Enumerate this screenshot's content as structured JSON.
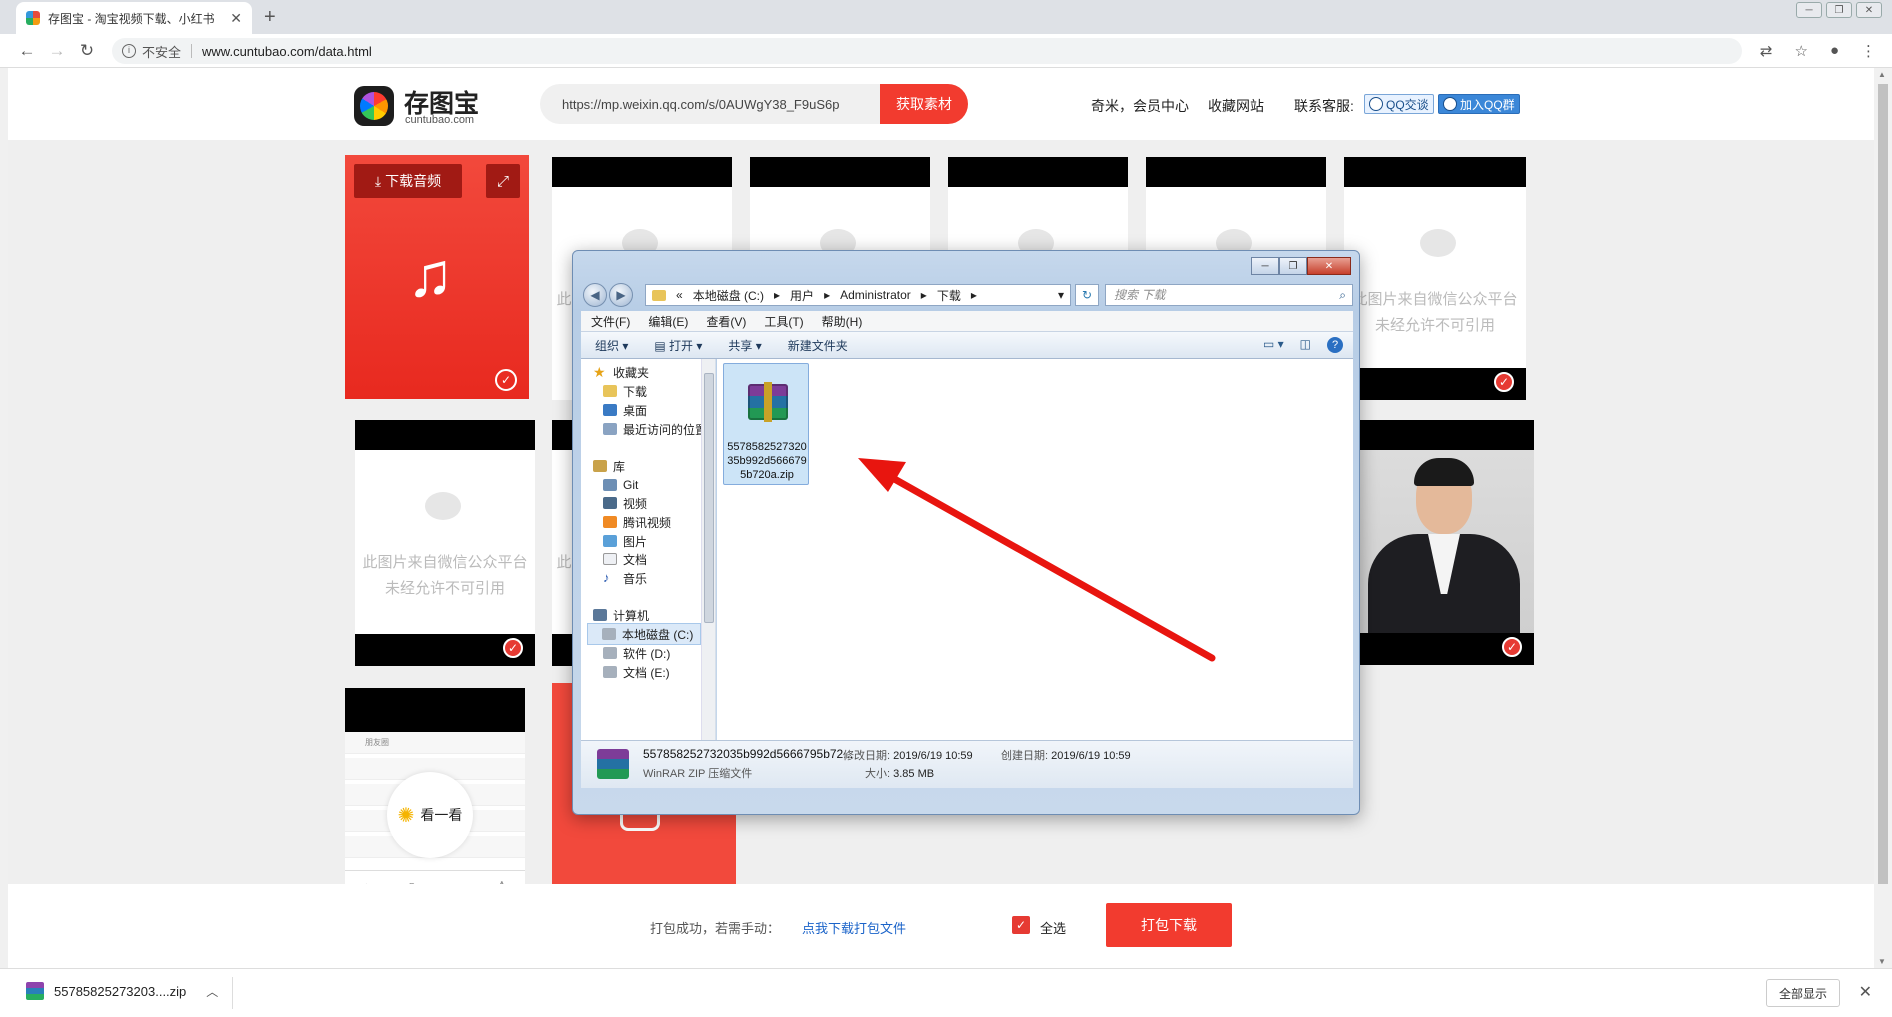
{
  "browser": {
    "tab_title": "存图宝 - 淘宝视频下载、小红书",
    "tab_close": "✕",
    "new_tab": "+",
    "security_label": "不安全",
    "url": "www.cuntubao.com/data.html",
    "window_controls": [
      "─",
      "❐",
      "✕"
    ]
  },
  "header": {
    "brand": "存图宝",
    "domain": "cuntubao.com",
    "search_value": "https://mp.weixin.qq.com/s/0AUWgY38_F9uS6p",
    "fetch_button": "获取素材",
    "member_center": "奇米，会员中心",
    "favorites": "收藏网站",
    "support_label": "联系客服:",
    "qq_talk": "QQ交谈",
    "qq_group": "加入QQ群"
  },
  "cards": {
    "placeholder_line1": "此图片来自微信公众平台",
    "placeholder_line2": "未经允许不可引用",
    "placeholder_partial": "此",
    "download_audio": "下载音频",
    "look_label": "看一看",
    "phone_row_label": "朋友圈",
    "check_mark": "✓"
  },
  "action_bar": {
    "pack_success": "打包成功，若需手动：",
    "pack_link": "点我下载打包文件",
    "select_all": "全选",
    "pack_download": "打包下载"
  },
  "explorer": {
    "path": [
      "«",
      "本地磁盘 (C:)",
      "用户",
      "Administrator",
      "下载"
    ],
    "search_placeholder": "搜索 下载",
    "menu": [
      "文件(F)",
      "编辑(E)",
      "查看(V)",
      "工具(T)",
      "帮助(H)"
    ],
    "toolbar": [
      "组织 ▾",
      "打开 ▾",
      "共享 ▾",
      "新建文件夹"
    ],
    "nav": {
      "favorites": "收藏夹",
      "downloads": "下载",
      "desktop": "桌面",
      "recent": "最近访问的位置",
      "libraries": "库",
      "git": "Git",
      "videos": "视频",
      "tencent_video": "腾讯视频",
      "pictures": "图片",
      "documents": "文档",
      "music": "音乐",
      "computer": "计算机",
      "drive_c": "本地磁盘 (C:)",
      "drive_d": "软件 (D:)",
      "drive_e": "文档 (E:)"
    },
    "file_name": "5578582527320 35b992d566679 5b720a.zip",
    "details": {
      "name": "557858252732035b992d5666795b72...",
      "type": "WinRAR ZIP 压缩文件",
      "modified_label": "修改日期:",
      "modified": "2019/6/19 10:59",
      "created_label": "创建日期:",
      "created": "2019/6/19 10:59",
      "size_label": "大小:",
      "size": "3.85 MB"
    }
  },
  "download_shelf": {
    "file": "55785825273203....zip",
    "show_all": "全部显示",
    "close": "✕"
  },
  "colors": {
    "brand_red": "#f23b2f",
    "link_blue": "#1a63c9",
    "arrow_red": "#e8150f"
  },
  "icons": [
    "back-icon",
    "forward-icon",
    "reload-icon",
    "info-icon",
    "translate-icon",
    "star-icon",
    "account-icon",
    "menu-icon",
    "download-icon",
    "expand-icon",
    "music-note-icon",
    "wechat-icon",
    "check-icon",
    "winrar-icon",
    "folder-icon",
    "search-icon",
    "help-icon"
  ]
}
